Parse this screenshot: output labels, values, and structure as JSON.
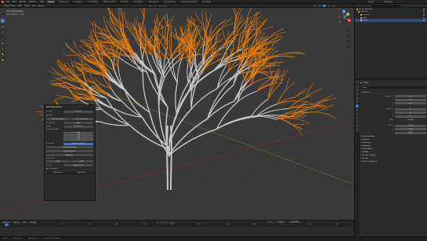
{
  "topbar": {
    "menus": [
      "File",
      "Edit",
      "Render",
      "Window",
      "Help"
    ],
    "workspaces": [
      "Layout",
      "Modeling",
      "Sculpting",
      "UV Editing",
      "Texture Paint",
      "Shading",
      "Animation",
      "Rendering",
      "Compositing",
      "Geometry Nodes",
      "Scripting"
    ],
    "active_workspace": "Layout",
    "scene": "Scene",
    "view_layer": "ViewLayer"
  },
  "viewport_header": {
    "mode": "Object Mode",
    "menus": [
      "View",
      "Select",
      "Add",
      "Object"
    ]
  },
  "viewport": {
    "view_name": "User Perspective",
    "collection_info": "(1) Collection | Curve",
    "gizmo": {
      "x": "X",
      "y": "Y",
      "z": "Z"
    }
  },
  "toolbar": {
    "tools": [
      "cursor",
      "move",
      "rotate",
      "scale",
      "transform",
      "annotate",
      "measure",
      "add"
    ]
  },
  "operator_panel": {
    "title": "Add Sapling Tree",
    "rows": [
      {
        "label": "Settings",
        "value": "Geometry"
      },
      {
        "label": "Bevel",
        "value": ""
      }
    ],
    "bevel_checked": true,
    "button_pair": [
      "Curve Resolution",
      "Curve Resolution"
    ],
    "handle_type": {
      "label": "Handle Type",
      "value": "Auto"
    },
    "shape": {
      "label": "Shape",
      "value": "Tend Flame"
    },
    "secondary_label": "Secondary Splits",
    "grid_values": [
      "0.60",
      "0.20",
      "0.20",
      "0.20"
    ],
    "attach": {
      "label": "Tree Scale",
      "value": "Custom Tree Scale"
    },
    "more_rows": [
      "Branch Distribution",
      "Leaf Distribution",
      "Base Size"
    ],
    "prune_label": "Prune Ratio",
    "pair2": [
      "0.50",
      "0.05"
    ],
    "preset_label": "Presets",
    "preset_value": "Export Preset",
    "checks": [
      "Limit Imports"
    ],
    "footer": [
      "Limit Imports",
      "Load Preset"
    ]
  },
  "timeline": {
    "menus": [
      "Playback",
      "Keying",
      "View",
      "Marker"
    ],
    "start": "Start 1",
    "end": "End 250",
    "current": "1",
    "ticks": [
      "0",
      "20",
      "40",
      "60",
      "80",
      "100",
      "120",
      "140",
      "160",
      "180",
      "200",
      "220",
      "240"
    ]
  },
  "statusbar": {
    "items": [
      "Select",
      "Box Select",
      "Rotate View",
      "Object Context Menu"
    ]
  },
  "outliner": {
    "items": [
      {
        "name": "Scene Collection",
        "selected": false
      },
      {
        "name": "Collection",
        "selected": false
      },
      {
        "name": "Camera",
        "selected": false
      },
      {
        "name": "Light",
        "selected": false
      },
      {
        "name": "Curve",
        "selected": true
      }
    ]
  },
  "properties": {
    "object_name": "Curve",
    "name_field": "Curve",
    "panels": {
      "transform": {
        "title": "Transform",
        "location": [
          "0 m",
          "0 m",
          "0 m"
        ],
        "rotation": [
          "0°",
          "0°",
          "0°"
        ],
        "mode": "XYZ Euler",
        "scale": [
          "1.000",
          "1.000",
          "1.000"
        ]
      }
    },
    "labels": {
      "location": "Location X",
      "y": "Y",
      "z": "Z",
      "rotation": "Rotation X",
      "mode": "Mode",
      "scale": "Scale X"
    },
    "closed_panels": [
      "Delta Transform",
      "Relations",
      "Collections",
      "Instancing",
      "Motion Paths",
      "Visibility",
      "Viewport Display",
      "Line Art",
      "Custom Properties"
    ]
  },
  "colors": {
    "accent": "#4772b3",
    "selected_branch": "#e87d0d",
    "branch": "#c7c7c7"
  }
}
